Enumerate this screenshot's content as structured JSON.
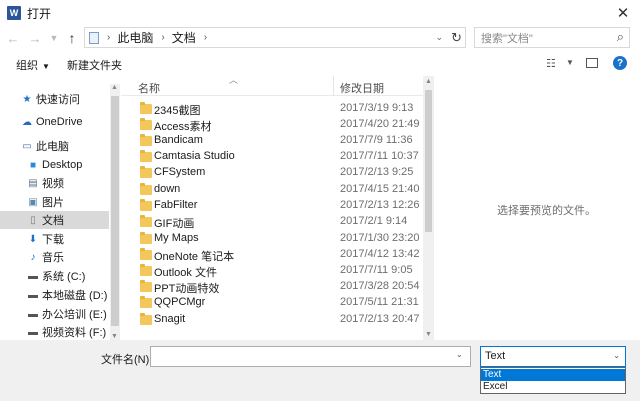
{
  "window": {
    "title": "打开",
    "app_icon_letter": "W"
  },
  "nav": {
    "breadcrumbs": [
      "此电脑",
      "文档"
    ],
    "search_placeholder": "搜索\"文档\""
  },
  "toolbar": {
    "organize_label": "组织",
    "new_folder_label": "新建文件夹"
  },
  "sidebar": {
    "items": [
      {
        "label": "快速访问",
        "icon": "star-icon",
        "color": "#1a73c8"
      },
      {
        "label": "OneDrive",
        "icon": "cloud-icon",
        "color": "#2b6ab7"
      },
      {
        "label": "此电脑",
        "icon": "computer-icon",
        "color": "#4a6fa5"
      },
      {
        "label": "Desktop",
        "icon": "desktop-icon",
        "color": "#2b8ae0"
      },
      {
        "label": "视频",
        "icon": "video-icon",
        "color": "#5a6d86"
      },
      {
        "label": "图片",
        "icon": "pictures-icon",
        "color": "#5a86b0"
      },
      {
        "label": "文档",
        "icon": "documents-icon",
        "color": "#6e7c8e"
      },
      {
        "label": "下载",
        "icon": "download-icon",
        "color": "#1a73c8"
      },
      {
        "label": "音乐",
        "icon": "music-icon",
        "color": "#1a73c8"
      },
      {
        "label": "系统 (C:)",
        "icon": "drive-c-icon",
        "color": "#555555"
      },
      {
        "label": "本地磁盘 (D:)",
        "icon": "drive-d-icon",
        "color": "#555555"
      },
      {
        "label": "办公培训 (E:)",
        "icon": "drive-e-icon",
        "color": "#555555"
      },
      {
        "label": "视频资料 (F:)",
        "icon": "drive-f-icon",
        "color": "#555555"
      }
    ]
  },
  "filelist": {
    "columns": [
      "名称",
      "修改日期"
    ],
    "rows": [
      {
        "name": "2345截图",
        "date": "2017/3/19 9:13"
      },
      {
        "name": "Access素材",
        "date": "2017/4/20 21:49"
      },
      {
        "name": "Bandicam",
        "date": "2017/7/9 11:36"
      },
      {
        "name": "Camtasia Studio",
        "date": "2017/7/11 10:37"
      },
      {
        "name": "CFSystem",
        "date": "2017/2/13 9:25"
      },
      {
        "name": "down",
        "date": "2017/4/15 21:40"
      },
      {
        "name": "FabFilter",
        "date": "2017/2/13 12:26"
      },
      {
        "name": "GIF动画",
        "date": "2017/2/1 9:14"
      },
      {
        "name": "My Maps",
        "date": "2017/1/30 23:20"
      },
      {
        "name": "OneNote 笔记本",
        "date": "2017/4/12 13:42"
      },
      {
        "name": "Outlook 文件",
        "date": "2017/7/11 9:05"
      },
      {
        "name": "PPT动画特效",
        "date": "2017/3/28 20:54"
      },
      {
        "name": "QQPCMgr",
        "date": "2017/5/11 21:31"
      },
      {
        "name": "Snagit",
        "date": "2017/2/13 20:47"
      }
    ]
  },
  "preview": {
    "message": "选择要预览的文件。"
  },
  "bottom": {
    "filename_label": "文件名(N):",
    "filename_value": "",
    "type_selected": "Text",
    "type_options": [
      "Text",
      "Excel"
    ]
  },
  "colors": {
    "accent": "#0078d7",
    "selected_bg": "#d9d9d9",
    "folder": "#f3c75a"
  }
}
